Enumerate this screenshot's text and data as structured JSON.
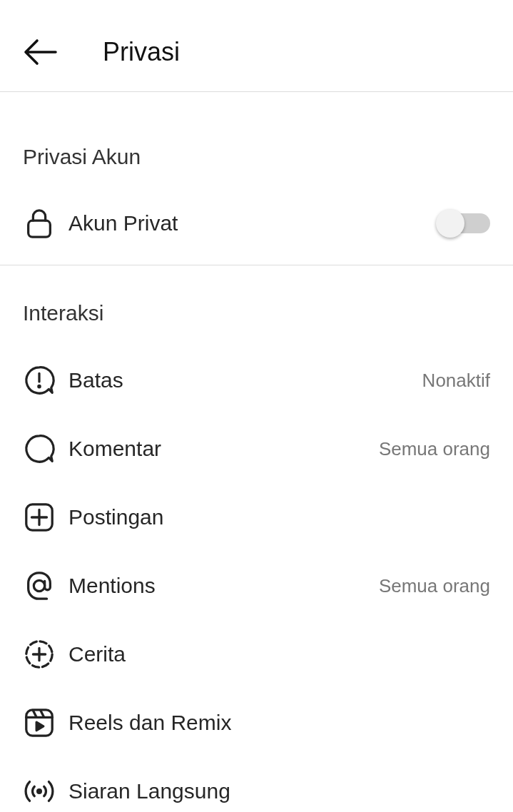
{
  "header": {
    "title": "Privasi"
  },
  "account_section": {
    "heading": "Privasi Akun",
    "items": [
      {
        "label": "Akun Privat",
        "on": false
      }
    ]
  },
  "interaction_section": {
    "heading": "Interaksi",
    "items": [
      {
        "label": "Batas",
        "value": "Nonaktif"
      },
      {
        "label": "Komentar",
        "value": "Semua orang"
      },
      {
        "label": "Postingan"
      },
      {
        "label": "Mentions",
        "value": "Semua orang"
      },
      {
        "label": "Cerita"
      },
      {
        "label": "Reels dan Remix"
      },
      {
        "label": "Siaran Langsung"
      }
    ]
  }
}
